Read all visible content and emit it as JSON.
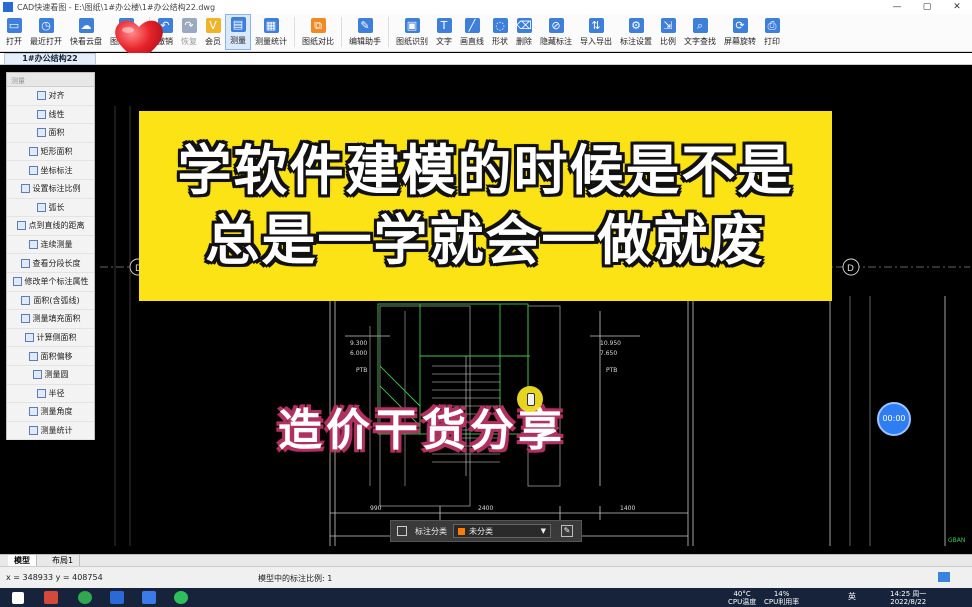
{
  "window": {
    "title": "CAD快速看图 - E:\\图纸\\1#办公楼\\1#办公结构22.dwg",
    "minimize": "—",
    "maximize": "▢",
    "close": "✕"
  },
  "toolbar": {
    "items": [
      {
        "label": "打开",
        "icon": "folder-icon",
        "color": "#3d7fd9"
      },
      {
        "label": "最近打开",
        "icon": "clock-icon",
        "color": "#3d7fd9"
      },
      {
        "label": "快看云盘",
        "icon": "cloud-icon",
        "color": "#3d7fd9"
      },
      {
        "label": "图层管理",
        "icon": "layers-icon",
        "color": "#3d7fd9"
      },
      {
        "label": "撤销",
        "icon": "undo-icon",
        "color": "#3d7fd9"
      },
      {
        "label": "恢复",
        "icon": "redo-icon",
        "color": "#9aa9bd"
      },
      {
        "label": "会员",
        "icon": "vip-icon",
        "color": "#f0b429"
      },
      {
        "label": "测量",
        "icon": "ruler-icon",
        "color": "#3d7fd9"
      },
      {
        "label": "测量统计",
        "icon": "stats-icon",
        "color": "#3d7fd9"
      },
      {
        "label": "图纸对比",
        "icon": "compare-icon",
        "color": "#f08a24"
      },
      {
        "label": "编辑助手",
        "icon": "edit-helper-icon",
        "color": "#3d7fd9"
      },
      {
        "label": "图纸识别",
        "icon": "recognize-icon",
        "color": "#3d7fd9"
      },
      {
        "label": "文字",
        "icon": "text-icon",
        "color": "#3d7fd9"
      },
      {
        "label": "画直线",
        "icon": "line-icon",
        "color": "#3d7fd9"
      },
      {
        "label": "形状",
        "icon": "shape-icon",
        "color": "#3d7fd9"
      },
      {
        "label": "删除",
        "icon": "eraser-icon",
        "color": "#3d7fd9"
      },
      {
        "label": "隐藏标注",
        "icon": "eye-off-icon",
        "color": "#3d7fd9"
      },
      {
        "label": "导入导出",
        "icon": "import-export-icon",
        "color": "#3d7fd9"
      },
      {
        "label": "标注设置",
        "icon": "annotation-settings-icon",
        "color": "#3d7fd9"
      },
      {
        "label": "比例",
        "icon": "scale-icon",
        "color": "#3d7fd9"
      },
      {
        "label": "文字查找",
        "icon": "find-text-icon",
        "color": "#3d7fd9"
      },
      {
        "label": "屏幕旋转",
        "icon": "rotate-icon",
        "color": "#3d7fd9"
      },
      {
        "label": "打印",
        "icon": "print-icon",
        "color": "#3d7fd9"
      }
    ],
    "active_index": 7
  },
  "document_tab": {
    "label": "1#办公结构22"
  },
  "measure_panel": {
    "header": "测量",
    "items": [
      "对齐",
      "线性",
      "面积",
      "矩形面积",
      "坐标标注",
      "设置标注比例",
      "弧长",
      "点到直线的距离",
      "连续测量",
      "查看分段长度",
      "修改单个标注属性",
      "面积(含弧线)",
      "测量填充面积",
      "计算侧面积",
      "面积偏移",
      "测量圆",
      "半径",
      "测量角度",
      "测量统计"
    ]
  },
  "overlay": {
    "line1": "学软件建模的时候是不是",
    "line2": "总是一学就会一做就废",
    "subtitle": "造价干货分享"
  },
  "cad": {
    "axis_left": "D",
    "axis_right": "D",
    "left_elev": "9.300",
    "left_elev2": "6.000",
    "right_elev": "10.950",
    "right_elev2": "7.650",
    "left_room": "PTB",
    "right_room": "PTB",
    "dim_left": "990",
    "dim_mid": "2400",
    "dim_right": "1400",
    "grid_label_right": "GBAN"
  },
  "record_button": {
    "label": "00:00"
  },
  "floating_bar": {
    "label": "标注分类",
    "value": "未分类"
  },
  "model_tabs": [
    "模型",
    "布局1"
  ],
  "status": {
    "coords": "x = 348933  y = 408754",
    "scale": "模型中的标注比例: 1"
  },
  "taskbar": {
    "temp": "40°C",
    "temp_label": "CPU温度",
    "cpu": "14%",
    "cpu_label": "CPU利用率",
    "lang": "英",
    "time": "14:25 周一",
    "date": "2022/8/22"
  }
}
